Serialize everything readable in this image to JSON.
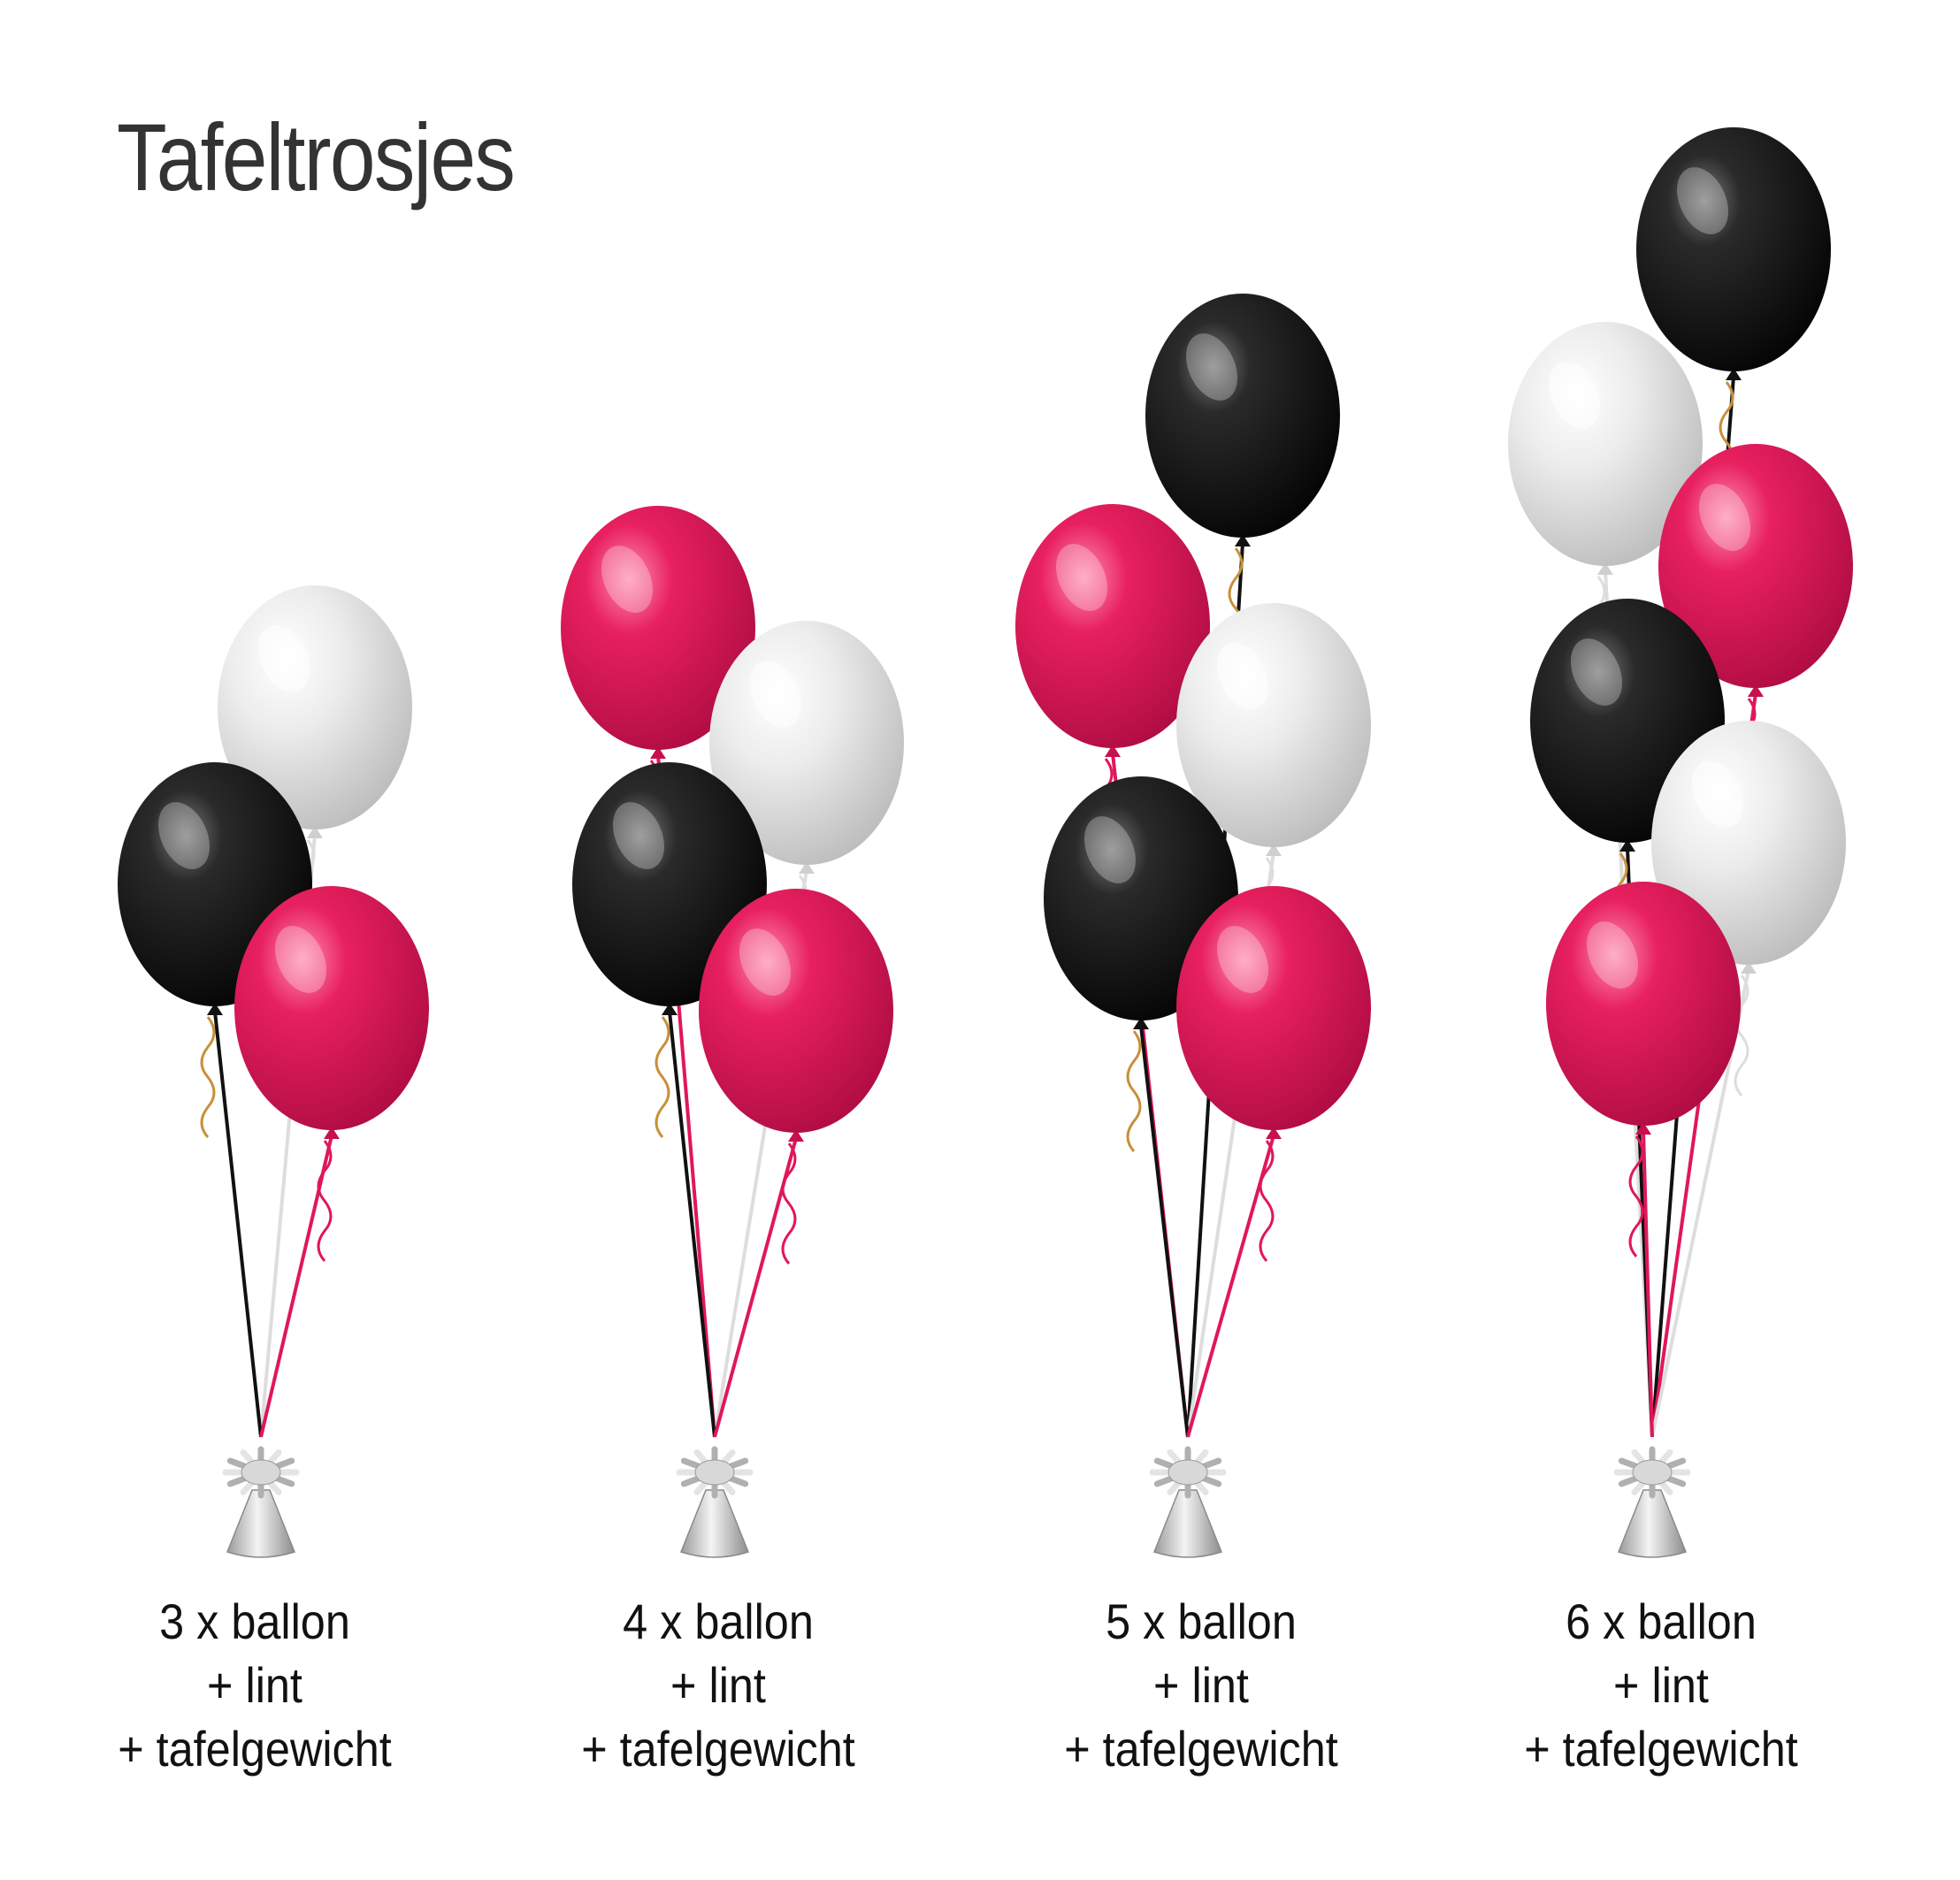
{
  "title": "Tafeltrosjes",
  "colors": {
    "black": "#111111",
    "pink": "#e0175a",
    "white": "#e8e8e8",
    "weight": "#c9c9c9",
    "text": "#111111",
    "title": "#333333"
  },
  "bunches": [
    {
      "balloons": 3,
      "colors": [
        "white",
        "black",
        "pink"
      ],
      "caption": [
        "3 x ballon",
        "+ lint",
        "+ tafelgewicht"
      ]
    },
    {
      "balloons": 4,
      "colors": [
        "pink",
        "white",
        "black",
        "pink"
      ],
      "caption": [
        "4 x ballon",
        "+ lint",
        "+ tafelgewicht"
      ]
    },
    {
      "balloons": 5,
      "colors": [
        "black",
        "pink",
        "white",
        "black",
        "pink"
      ],
      "caption": [
        "5 x ballon",
        "+ lint",
        "+ tafelgewicht"
      ]
    },
    {
      "balloons": 6,
      "colors": [
        "black",
        "white",
        "pink",
        "black",
        "white",
        "pink"
      ],
      "caption": [
        "6 x ballon",
        "+ lint",
        "+ tafelgewicht"
      ]
    }
  ]
}
